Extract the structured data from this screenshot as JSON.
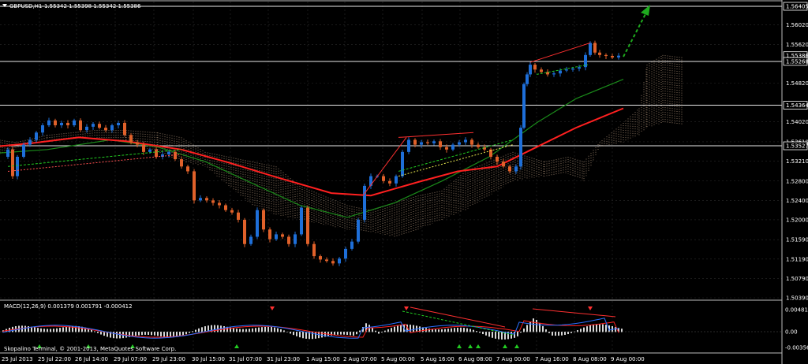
{
  "header": {
    "symbol_timeframe": "GBPUSD,H1",
    "ohlc": "1.55342 1.55398 1.55342 1.55386"
  },
  "indicator": {
    "macd_label": "MACD(12,26,9) 0.001379 0.001791 -0.000412",
    "macd_scale": [
      "0.004812",
      "0.00",
      "-0.00356"
    ]
  },
  "watermark": "Skopalino Terminal, © 2001-2013, MetaQuotes Software Corp.",
  "price_axis": [
    "1.56405",
    "1.56020",
    "1.55620",
    "1.55386",
    "1.55268",
    "1.54820",
    "1.54364",
    "1.54020",
    "1.53610",
    "1.53527",
    "1.53210",
    "1.52800",
    "1.52400",
    "1.52000",
    "1.51590",
    "1.51190",
    "1.50790",
    "1.50390"
  ],
  "time_axis": [
    "25 Jul 2013",
    "25 Jul 22:00",
    "26 Jul 14:00",
    "29 Jul 07:00",
    "29 Jul 23:00",
    "30 Jul 15:00",
    "31 Jul 07:00",
    "31 Jul 23:00",
    "1 Aug 15:00",
    "2 Aug 07:00",
    "5 Aug 00:00",
    "5 Aug 16:00",
    "6 Aug 08:00",
    "7 Aug 00:00",
    "7 Aug 16:00",
    "8 Aug 08:00",
    "9 Aug 00:00"
  ],
  "horizontal_levels": [
    "1.56405",
    "1.55268",
    "1.54364",
    "1.53527"
  ],
  "colors": {
    "background": "#000000",
    "grid": "#2b2b2b",
    "bull_candle": "#1e6fd9",
    "bear_candle": "#e0612a",
    "ma_fast": "#ff2020",
    "ma_slow": "#1a8a1a",
    "cloud": "#e8c4a0",
    "macd_hist": "#d8d8d8",
    "macd_signal": "#ff2020",
    "macd_line": "#2a6fff",
    "up_arrow": "#22cc22",
    "down_arrow": "#ff3030",
    "projection_arrow": "#1faa1f"
  }
}
